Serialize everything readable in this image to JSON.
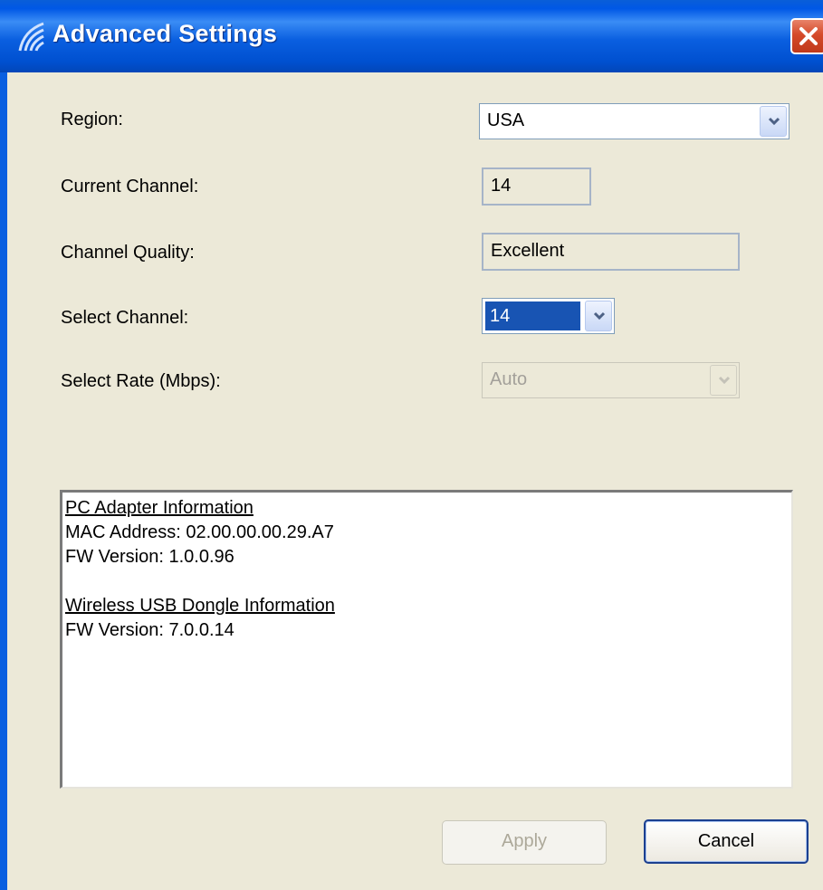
{
  "window": {
    "title": "Advanced Settings",
    "app_icon": "signal-waves-icon",
    "close_icon": "close-x-icon"
  },
  "form": {
    "region": {
      "label": "Region:",
      "value": "USA"
    },
    "current_channel": {
      "label": "Current Channel:",
      "value": "14"
    },
    "channel_quality": {
      "label": "Channel Quality:",
      "value": "Excellent"
    },
    "select_channel": {
      "label": "Select Channel:",
      "value": "14"
    },
    "select_rate": {
      "label": "Select Rate (Mbps):",
      "value": "Auto"
    }
  },
  "info": {
    "pc_heading": "PC Adapter Information",
    "mac": "MAC Address: 02.00.00.00.29.A7",
    "pc_fw": "FW Version: 1.0.0.96",
    "dongle_heading": "Wireless USB Dongle Information",
    "dongle_fw": "FW Version: 7.0.0.14"
  },
  "buttons": {
    "apply": "Apply",
    "cancel": "Cancel"
  },
  "colors": {
    "titlebar": "#0a5fe0",
    "dialog_bg": "#ece9d8",
    "selection": "#1854b3",
    "close": "#d54a2a"
  }
}
